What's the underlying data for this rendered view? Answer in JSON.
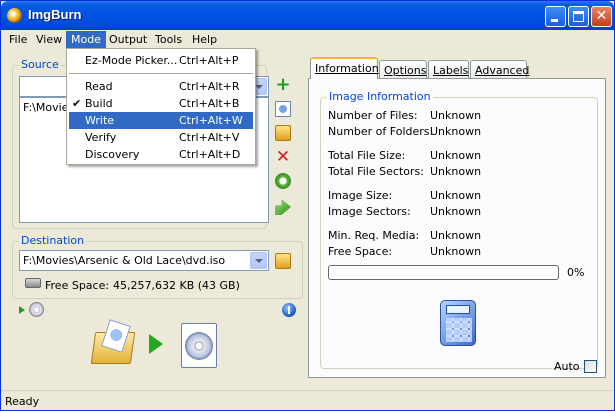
{
  "window": {
    "title": "ImgBurn"
  },
  "menubar": {
    "items": [
      "File",
      "View",
      "Mode",
      "Output",
      "Tools",
      "Help"
    ],
    "active": "Mode"
  },
  "mode_menu": {
    "items": [
      {
        "label": "Ez-Mode Picker...",
        "shortcut": "Ctrl+Alt+P"
      },
      {
        "label": "Read",
        "shortcut": "Ctrl+Alt+R"
      },
      {
        "label": "Build",
        "shortcut": "Ctrl+Alt+B",
        "checked": true
      },
      {
        "label": "Write",
        "shortcut": "Ctrl+Alt+W",
        "highlighted": true
      },
      {
        "label": "Verify",
        "shortcut": "Ctrl+Alt+V"
      },
      {
        "label": "Discovery",
        "shortcut": "Ctrl+Alt+D"
      }
    ],
    "check_mark": "✔"
  },
  "source": {
    "label": "Source",
    "list_item": "F:\\Movie"
  },
  "destination": {
    "label": "Destination",
    "path": "F:\\Movies\\Arsenic & Old Lace\\dvd.iso",
    "free_space_label": "Free Space:",
    "free_space_value": "45,257,632 KB  (43 GB)"
  },
  "tabs": [
    {
      "label": "Information",
      "active": true
    },
    {
      "label": "Options"
    },
    {
      "label": "Labels"
    },
    {
      "label": "Advanced"
    }
  ],
  "image_info": {
    "label": "Image Information",
    "rows": [
      {
        "label": "Number of Files:",
        "value": "Unknown"
      },
      {
        "label": "Number of Folders:",
        "value": "Unknown"
      },
      {
        "label": "Total File Size:",
        "value": "Unknown"
      },
      {
        "label": "Total File Sectors:",
        "value": "Unknown"
      },
      {
        "label": "Image Size:",
        "value": "Unknown"
      },
      {
        "label": "Image Sectors:",
        "value": "Unknown"
      },
      {
        "label": "Min. Req. Media:",
        "value": "Unknown"
      },
      {
        "label": "Free Space:",
        "value": "Unknown"
      }
    ],
    "progress_percent": 0,
    "progress_label": "0%",
    "auto_label": "Auto",
    "auto_checked": false
  },
  "status": {
    "text": "Ready"
  },
  "colors": {
    "title_bar": "#0054e3",
    "menu_highlight": "#316ac5",
    "group_label": "#0046d5",
    "play": "#22a822"
  },
  "icons": [
    "app-icon",
    "add-icon",
    "file-icon",
    "folder-icon",
    "delete-icon",
    "refresh-icon",
    "calculate-icon",
    "browse-folder-icon",
    "harddrive-icon",
    "disc-icon",
    "info-icon",
    "build-folder-icon",
    "play-icon",
    "iso-disc-icon",
    "calculator-icon"
  ]
}
